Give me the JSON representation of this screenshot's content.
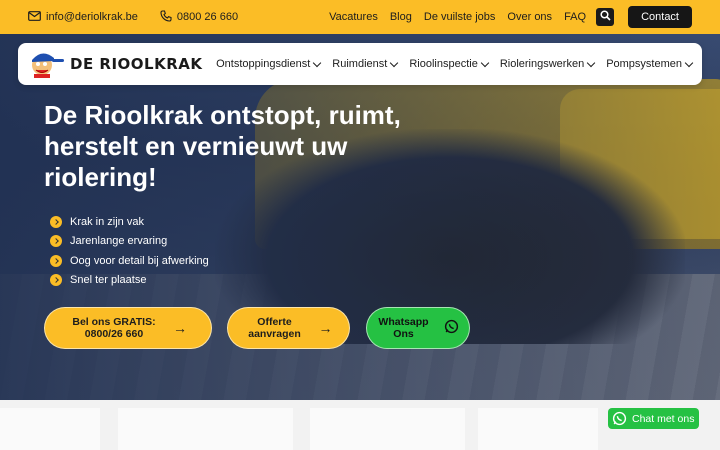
{
  "topbar": {
    "email": "info@deriolkrak.be",
    "phone": "0800 26 660",
    "links": [
      "Vacatures",
      "Blog",
      "De vuilste jobs",
      "Over ons",
      "FAQ"
    ],
    "contact_label": "Contact",
    "accent": "#fbbd26"
  },
  "nav": {
    "logo_text": "DE RIOOLKRAK",
    "menu": [
      "Ontstoppingsdienst",
      "Ruimdienst",
      "Rioolinspectie",
      "Rioleringswerken",
      "Pompsystemen"
    ]
  },
  "hero": {
    "headline": "De Rioolkrak ontstopt, ruimt, herstelt en vernieuwt uw riolering!",
    "bullets": [
      "Krak in zijn vak",
      "Jarenlange ervaring",
      "Oog voor detail bij afwerking",
      "Snel ter plaatse"
    ],
    "cta_call_label": "Bel ons GRATIS: 0800/26 660",
    "cta_quote_label": "Offerte aanvragen",
    "cta_whatsapp_label": "Whatsapp Ons"
  },
  "chat": {
    "label": "Chat met ons",
    "color": "#25c143"
  },
  "icons": [
    "mail-icon",
    "phone-icon",
    "search-icon",
    "chevron-down-icon",
    "arrow-right-icon",
    "whatsapp-icon",
    "check-bullet-icon"
  ]
}
